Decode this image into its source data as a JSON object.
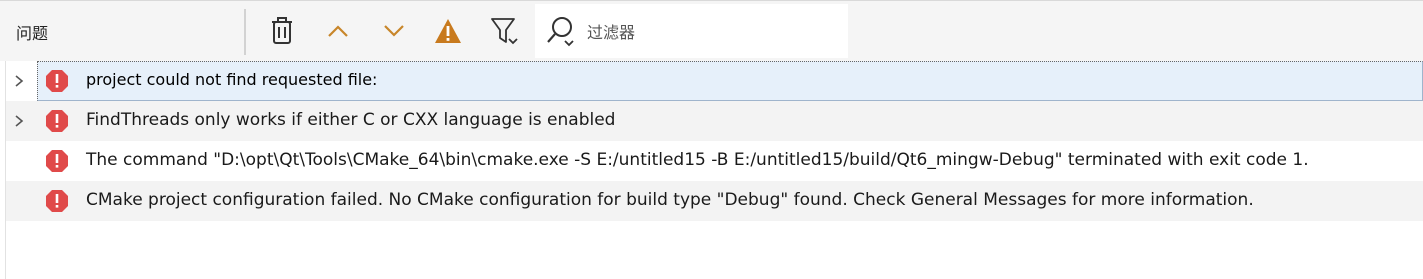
{
  "panel": {
    "title": "问题"
  },
  "toolbar": {
    "buttons": [
      {
        "name": "clear-button",
        "icon": "trash-icon"
      },
      {
        "name": "previous-button",
        "icon": "chevron-up-icon"
      },
      {
        "name": "next-button",
        "icon": "chevron-down-icon"
      },
      {
        "name": "warnings-toggle",
        "icon": "warning-icon"
      },
      {
        "name": "filter-menu-button",
        "icon": "filter-icon"
      }
    ],
    "filter": {
      "placeholder": "过滤器",
      "value": ""
    }
  },
  "issues": [
    {
      "type": "error",
      "expandable": true,
      "message": "project could not find requested file:"
    },
    {
      "type": "error",
      "expandable": true,
      "message": "FindThreads only works if either C or CXX language is enabled"
    },
    {
      "type": "error",
      "expandable": false,
      "message": "The command \"D:\\opt\\Qt\\Tools\\CMake_64\\bin\\cmake.exe -S E:/untitled15 -B E:/untitled15/build/Qt6_mingw-Debug\" terminated with exit code 1."
    },
    {
      "type": "error",
      "expandable": false,
      "message": "CMake project configuration failed. No CMake configuration for build type \"Debug\" found. Check General Messages for more information."
    }
  ],
  "colors": {
    "error": "#e04a4a",
    "accent": "#c8862a",
    "warning": "#c87a1e"
  }
}
